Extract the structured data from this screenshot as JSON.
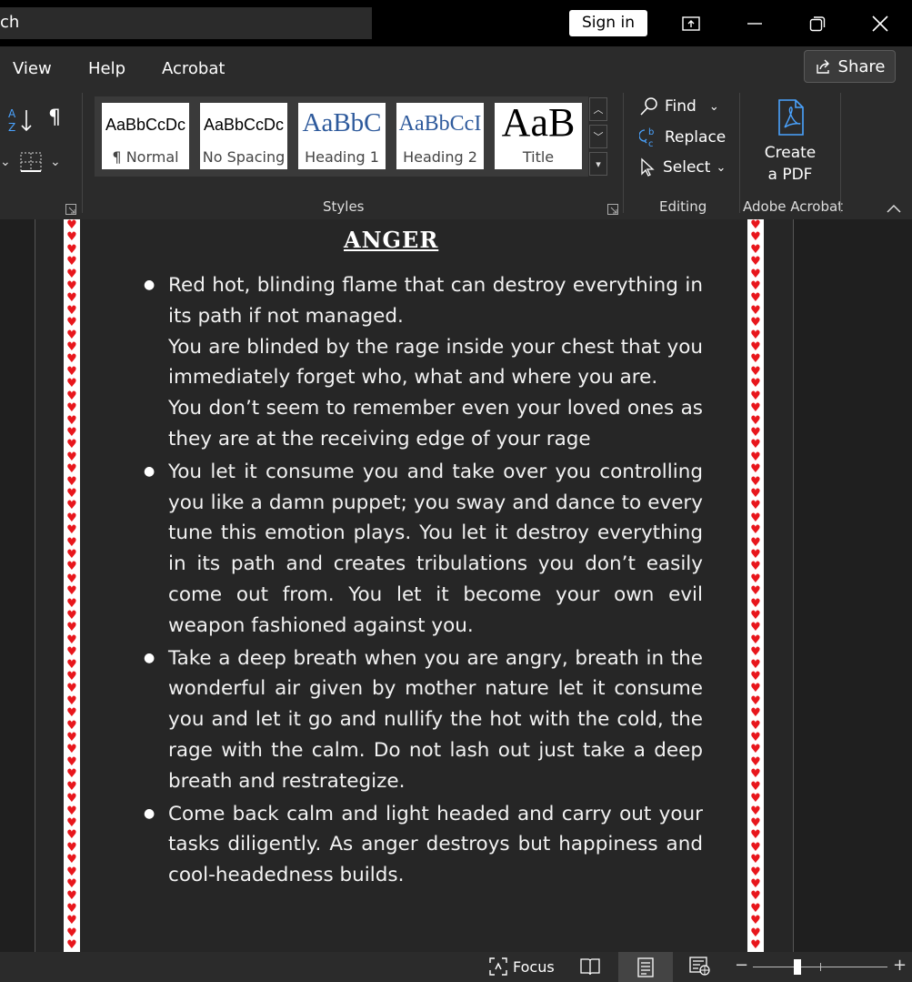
{
  "titlebar": {
    "search_text": "ch",
    "sign_in": "Sign in"
  },
  "menu": {
    "items": [
      "View",
      "Help",
      "Acrobat"
    ],
    "share": "Share"
  },
  "ribbon": {
    "styles": [
      {
        "sample": "AaBbCcDc",
        "label": "¶ Normal"
      },
      {
        "sample": "AaBbCcDc",
        "label": "No Spacing"
      },
      {
        "sample": "AaBbC",
        "label": "Heading 1"
      },
      {
        "sample": "AaBbCcI",
        "label": "Heading 2"
      },
      {
        "sample": "AaB",
        "label": "Title"
      }
    ],
    "styles_group_label": "Styles",
    "editing": {
      "find": "Find",
      "replace": "Replace",
      "select": "Select",
      "label": "Editing"
    },
    "acrobat": {
      "create_line1": "Create",
      "create_line2": "a PDF",
      "label": "Adobe Acrobat"
    }
  },
  "document": {
    "title": "ANGER",
    "bullets": [
      {
        "lines": [
          "Red hot, blinding flame that can destroy everything in its path if not managed.",
          "You are blinded by the rage inside your chest that you immediately forget who, what and where you are.",
          "You don’t seem to remember even your loved ones as they are at the receiving edge of your rage"
        ]
      },
      {
        "lines": [
          "You let it consume you and take over you controlling you like a damn puppet; you sway and dance to every tune this emotion plays. You let it destroy everything in its path and creates tribulations you don’t easily come out from. You let it become your own evil weapon fashioned against you."
        ]
      },
      {
        "lines": [
          "Take a deep breath when you are angry, breath in the wonderful air given by mother nature let it consume you and let it go and nullify the hot with the cold, the rage with the calm. Do not lash out just take a deep breath and restrategize."
        ]
      },
      {
        "lines": [
          "Come back calm and light headed and carry out your tasks diligently. As anger destroys but happiness and cool-headedness builds."
        ]
      }
    ]
  },
  "statusbar": {
    "focus": "Focus",
    "zoom_minus": "−",
    "zoom_plus": "+"
  }
}
